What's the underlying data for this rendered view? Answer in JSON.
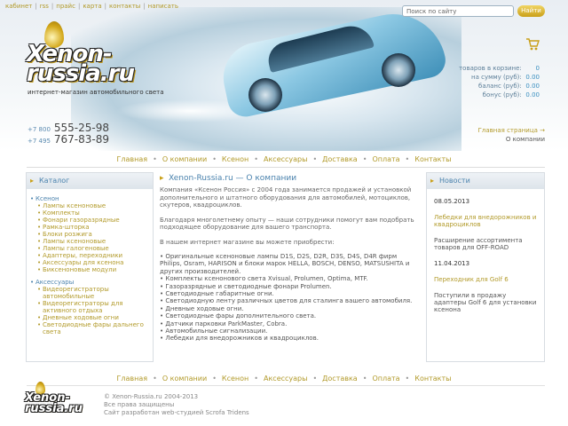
{
  "topnav": [
    "кабинет",
    "rss",
    "прайс",
    "карта",
    "контакты",
    "написать"
  ],
  "search": {
    "placeholder": "Поиск по сайту",
    "button": "Найти"
  },
  "logo": {
    "text": "Xenon-\nrussia.ru",
    "tagline": "интернет-магазин автомобильного света"
  },
  "cart": {
    "rows": [
      {
        "label": "товаров в корзине:",
        "value": "0"
      },
      {
        "label": "на сумму (руб):",
        "value": "0.00"
      },
      {
        "label": "баланс (руб):",
        "value": "0.00"
      },
      {
        "label": "бонус (руб):",
        "value": "0.00"
      }
    ]
  },
  "phones": [
    {
      "code": "+7 800",
      "number": "555-25-98"
    },
    {
      "code": "+7 495",
      "number": "767-83-89"
    }
  ],
  "breadcrumbs": {
    "home": "Главная страница →",
    "current": "О компании"
  },
  "mainnav": [
    "Главная",
    "О компании",
    "Ксенон",
    "Аксессуары",
    "Доставка",
    "Оплата",
    "Контакты"
  ],
  "catalog": {
    "title": "Каталог",
    "groups": [
      {
        "name": "Ксенон",
        "items": [
          "Лампы ксеноновые",
          "Комплекты",
          "Фонари газоразрядные",
          "Рамка-шторка",
          "Блоки розжига",
          "Лампы ксеноновые",
          "Лампы галогеновые",
          "Адаптеры, переходники",
          "Аксессуары для ксенона",
          "Биксеноновые модули"
        ]
      },
      {
        "name": "Аксессуары",
        "items": [
          "Видеорегистраторы автомобильные",
          "Видеорегистраторы для активного отдыха",
          "Дневные ходовые огни",
          "Светодиодные фары дальнего света"
        ]
      }
    ]
  },
  "content": {
    "title": "Xenon-Russia.ru — О компании",
    "p1": "Компания «Ксенон Россия» с 2004 года занимается продажей и установкой дополнительного и штатного оборудования для автомобилей, мотоциклов, скутеров, квадроциклов.",
    "p2": "Благодаря многолетнему опыту — наши сотрудники помогут вам подобрать подходящее оборудование для вашего транспорта.",
    "p3": "В нашем интернет магазине вы можете приобрести:",
    "list": [
      "• Оригинальные ксеноновые лампы D1S, D2S, D2R, D3S, D4S, D4R фирм Philips, Osram, HARISON и блоки марок HELLA, BOSCH, DENSO, MATSUSHITA и других производителей.",
      "• Комплекты ксенонового света Xvisual, Prolumen, Optima, MTF.",
      "• Газоразрядные и светодиодные фонари Prolumen.",
      "• Светодиодные габаритные огни.",
      "• Светодиодную ленту различных цветов для сталинга вашего автомобиля.",
      "• Дневные ходовые огни.",
      "• Светодиодные фары дополнительного света.",
      "• Датчики парковки ParkMaster, Cobra.",
      "• Автомобильные сигнализации.",
      "• Лебедки для внедорожников и квадроциклов."
    ]
  },
  "news": {
    "title": "Новости",
    "items": [
      {
        "date": "08.05.2013",
        "link": "Лебедки для внедорожников и квадроциклов",
        "text": "Расширение ассортимента товаров для OFF-ROAD"
      },
      {
        "date": "11.04.2013",
        "link": "Переходник для Golf 6",
        "text": "Поступили в продажу адаптеры Golf 6 для установки ксенона"
      }
    ]
  },
  "footer": {
    "nav": [
      "Главная",
      "О компании",
      "Ксенон",
      "Аксессуары",
      "Доставка",
      "Оплата",
      "Контакты"
    ],
    "copyright": "© Xenon-Russia.ru 2004-2013",
    "rights": "Все права защищены",
    "developer": "Сайт разработан web-студией Scrofa Tridens"
  },
  "colors": {
    "accent_gold": "#b29a2a",
    "accent_blue": "#4a82ad"
  }
}
